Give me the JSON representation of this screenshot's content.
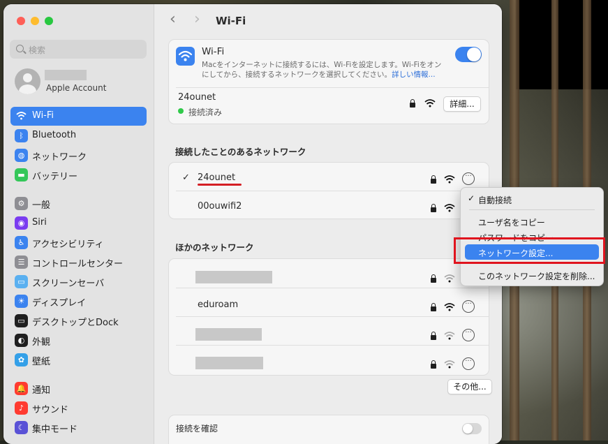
{
  "window": {
    "title": "Wi-Fi"
  },
  "sidebar": {
    "search_placeholder": "検索",
    "account_label": "Apple Account",
    "items": [
      {
        "label": "Wi-Fi",
        "icon": "wifi-icon",
        "color": "#3b83ef",
        "active": true
      },
      {
        "label": "Bluetooth",
        "icon": "bluetooth-icon",
        "color": "#3b83ef"
      },
      {
        "label": "ネットワーク",
        "icon": "globe-icon",
        "color": "#3b83ef"
      },
      {
        "label": "バッテリー",
        "icon": "battery-icon",
        "color": "#34c759"
      },
      {
        "label": "一般",
        "icon": "gear-icon",
        "color": "#8e8e93"
      },
      {
        "label": "Siri",
        "icon": "siri-icon",
        "color": "#7a3cf0"
      },
      {
        "label": "アクセシビリティ",
        "icon": "accessibility-icon",
        "color": "#3b83ef"
      },
      {
        "label": "コントロールセンター",
        "icon": "control-center-icon",
        "color": "#8e8e93"
      },
      {
        "label": "スクリーンセーバ",
        "icon": "screensaver-icon",
        "color": "#5ab0f0"
      },
      {
        "label": "ディスプレイ",
        "icon": "display-icon",
        "color": "#3b83ef"
      },
      {
        "label": "デスクトップとDock",
        "icon": "dock-icon",
        "color": "#1f1f1f"
      },
      {
        "label": "外観",
        "icon": "appearance-icon",
        "color": "#1f1f1f"
      },
      {
        "label": "壁紙",
        "icon": "wallpaper-icon",
        "color": "#34a0e8"
      },
      {
        "label": "通知",
        "icon": "bell-icon",
        "color": "#ff3b30"
      },
      {
        "label": "サウンド",
        "icon": "sound-icon",
        "color": "#ff3b30"
      },
      {
        "label": "集中モード",
        "icon": "moon-icon",
        "color": "#5a52d6"
      }
    ]
  },
  "wifi_card": {
    "title": "Wi-Fi",
    "description_line1": "Macをインターネットに接続するには、Wi-Fiを設定します。Wi-Fiをオン",
    "description_line2": "にしてから、接続するネットワークを選択してください。",
    "more_info_link": "詳しい情報...",
    "toggle_on": true,
    "current_network": "24ounet",
    "status": "接続済み",
    "details_button": "詳細..."
  },
  "known_networks": {
    "heading": "接続したことのあるネットワーク",
    "items": [
      {
        "name": "24ounet",
        "checked": true
      },
      {
        "name": "00ouwifi2",
        "checked": false
      }
    ]
  },
  "other_networks": {
    "heading": "ほかのネットワーク",
    "items": [
      {
        "name": "",
        "redacted": true
      },
      {
        "name": "eduroam",
        "redacted": false
      },
      {
        "name": "",
        "redacted": true
      },
      {
        "name": "",
        "redacted": true
      }
    ],
    "other_button": "その他..."
  },
  "ask_to_join": {
    "heading": "接続を確認",
    "toggle_on": false
  },
  "context_menu": {
    "items": [
      {
        "label": "自動接続",
        "checked": true
      },
      {
        "label": "ユーザ名をコピー"
      },
      {
        "label": "パスワードをコピー"
      },
      {
        "label": "ネットワーク設定...",
        "highlighted": true
      },
      {
        "label": "このネットワーク設定を削除..."
      }
    ]
  },
  "colors": {
    "accent": "#3b83ef",
    "annotation_red": "#e0141e"
  }
}
